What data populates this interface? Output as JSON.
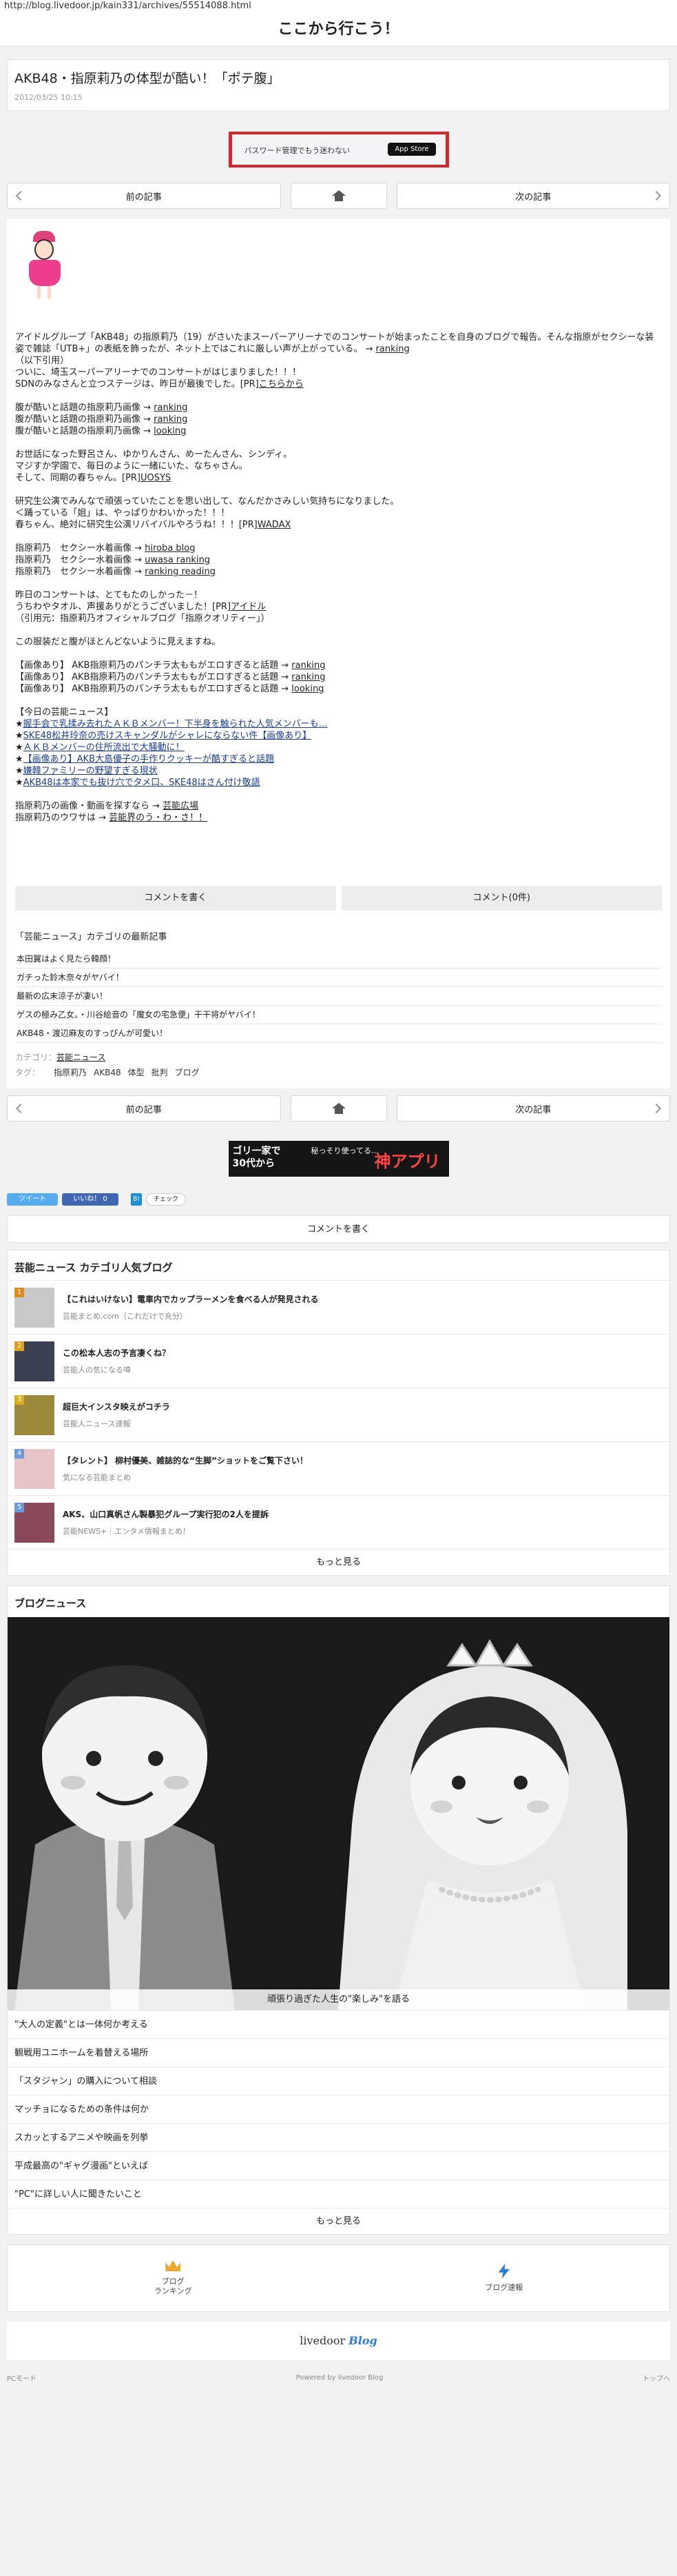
{
  "url": "http://blog.livedoor.jp/kain331/archives/55514088.html",
  "blog_title": "ここから行こう！",
  "article": {
    "title": "AKB48・指原莉乃の体型が酷い！「ポテ腹」",
    "date": "2012/03/25 10:15"
  },
  "ad_top": {
    "text": "パスワード管理でもう迷わない",
    "button": "App Store"
  },
  "nav": {
    "prev": "前の記事",
    "next": "次の記事"
  },
  "body": [
    {
      "t": "アイドルグループ「AKB48」の指原莉乃（19）がさいたまスーパーアリーナでのコンサートが始まったことを自身のブログで報告。そんな指原がセクシーな装姿で雑誌「UTB+」の表紙を飾ったが、ネット上ではこれに厳しい声が上がっている。 → ",
      "l": "ranking"
    },
    {
      "t": "（以下引用）"
    },
    {
      "t": "ついに、埼玉スーパーアリーナでのコンサートがはじまりました！！！"
    },
    {
      "t": "SDNのみなさんと立つステージは、昨日が最後でした。[PR]",
      "l": "こちらから"
    },
    {
      "gap": true
    },
    {
      "t": "腹が酷いと話題の指原莉乃画像 → ",
      "l": "ranking"
    },
    {
      "t": "腹が酷いと話題の指原莉乃画像 → ",
      "l": "ranking"
    },
    {
      "t": "腹が酷いと話題の指原莉乃画像 → ",
      "l": "looking"
    },
    {
      "gap": true
    },
    {
      "t": "お世話になった野呂さん、ゆかりんさん、めーたんさん、シンディ。"
    },
    {
      "t": "マジすか学園で、毎日のように一緒にいた、なちゃさん。"
    },
    {
      "t": "そして、同期の春ちゃん。[PR]",
      "l": "UOSYS"
    },
    {
      "gap": true
    },
    {
      "t": "研究生公演でみんなで頑張っていたことを思い出して、なんだかさみしい気持ちになりました。"
    },
    {
      "t": "＜踊っている「姐」は、やっぱりかわいかった！！！"
    },
    {
      "t": "春ちゃん、絶対に研究生公演リバイバルやろうね！！！[PR]",
      "l": "WADAX"
    },
    {
      "gap": true
    },
    {
      "t": "指原莉乃　セクシー水着画像 → ",
      "l": "hiroba blog"
    },
    {
      "t": "指原莉乃　セクシー水着画像 → ",
      "l": "uwasa ranking"
    },
    {
      "t": "指原莉乃　セクシー水着画像 → ",
      "l": "ranking reading"
    },
    {
      "gap": true
    },
    {
      "t": "昨日のコンサートは、とてもたのしかった－！"
    },
    {
      "t": "うちわやタオル、声援ありがとうございました！[PR]",
      "l": "アイドル"
    },
    {
      "t": "（引用元：指原莉乃オフィシャルブログ「指原クオリティー」）"
    },
    {
      "gap": true
    },
    {
      "t": "この服装だと腹がほとんどないように見えますね。"
    },
    {
      "gap": true
    },
    {
      "t": "【画像あり】 AKB指原莉乃のパンチラ太ももがエロすぎると話題 → ",
      "l": "ranking"
    },
    {
      "t": "【画像あり】 AKB指原莉乃のパンチラ太ももがエロすぎると話題 → ",
      "l": "ranking"
    },
    {
      "t": "【画像あり】 AKB指原莉乃のパンチラ太ももがエロすぎると話題 → ",
      "l": "looking"
    },
    {
      "gap": true
    },
    {
      "t": "【今日の芸能ニュース】"
    },
    {
      "t": "★",
      "l": "握手会で乳揉み去れたＡＫＢメンバー！下半身を触られた人気メンバーも…"
    },
    {
      "t": "★",
      "l": "SKE48松井玲奈の売けスキャンダルがシャレにならない件【画像あり】"
    },
    {
      "t": "★",
      "l": "ＡＫＢメンバーの住所流出で大騒動に！"
    },
    {
      "t": "★",
      "l": "【画像あり】AKB大島優子の手作りクッキーが酷すぎると話題"
    },
    {
      "t": "★",
      "l": "嫌韓ファミリーの野望すぎる現状"
    },
    {
      "t": "★",
      "l": "AKB48は本家でも抜け穴でタメ口、SKE48はさん付け敬語"
    },
    {
      "gap": true
    },
    {
      "t": "指原莉乃の画像・動画を探すなら → ",
      "l": "芸能広場"
    },
    {
      "t": "指原莉乃のウワサは → ",
      "l": "芸能界のう・わ・さ！！"
    }
  ],
  "comment_bar": {
    "write": "コメントを書く",
    "count": "コメント(0件)"
  },
  "category_latest": {
    "heading": "「芸能ニュース」カテゴリの最新記事",
    "items": [
      "本田翼はよく見たら韓顔！",
      "ガチった鈴木奈々がヤバイ！",
      "最新の広末涼子が凄い！",
      "ゲスの極み乙女。・川谷絵音の「魔女の宅急便」干干将がヤバイ！",
      "AKB48・渡辺麻友のすっぴんが可愛い！"
    ]
  },
  "meta": {
    "category_label": "カテゴリ：",
    "category": "芸能ニュース",
    "tags_label": "タグ：",
    "tags": [
      "指原莉乃",
      "AKB48",
      "体型",
      "批判",
      "ブログ"
    ]
  },
  "ad_mid": {
    "t1": "ゴリ一家で\n30代から",
    "t2": "秘っそり使ってる…",
    "t3": "神アプリ"
  },
  "social": {
    "tweet": "ツイート",
    "like": "いいね！ 0",
    "hatena": "B!",
    "check": "チェック"
  },
  "comment_write": "コメントを書く",
  "popular": {
    "heading": "芸能ニュース カテゴリ人気ブログ",
    "items": [
      {
        "rank": "1",
        "title": "【これはいけない】電車内でカップラーメンを食べる人が発見される",
        "src": "芸能まとめ.com（これだけで充分）"
      },
      {
        "rank": "2",
        "title": "この松本人志の予言凄くね？",
        "src": "芸能人の気になる噂"
      },
      {
        "rank": "3",
        "title": "超巨大インスタ映えがコチラ",
        "src": "芸能人ニュース速報"
      },
      {
        "rank": "4",
        "title": "【タレント】 柳村優美、雑誌的な“生脚”ショットをご覧下さい！",
        "src": "気になる芸能まとめ"
      },
      {
        "rank": "5",
        "title": "AKS、山口真帆さん製暴犯グループ実行犯の2人を提訴",
        "src": "芸能NEWS+｜エンタメ情報まとめ！"
      }
    ],
    "more": "もっと見る"
  },
  "blog_news": {
    "heading": "ブログニュース",
    "hero_caption": "頑張り過ぎた人生の\"楽しみ\"を語る",
    "items": [
      "\"大人の定義\"とは一体何か考える",
      "観戦用ユニホームを着替える場所",
      "「スタジャン」の購入について相談",
      "マッチョになるための条件は何か",
      "スカッとするアニメや映画を列挙",
      "平成最高の\"ギャグ漫画\"といえば",
      "\"PC\"に詳しい人に聞きたいこと"
    ],
    "more": "もっと見る"
  },
  "footer_nav": {
    "ranking": "ブログ\nランキング",
    "flash": "ブログ速報"
  },
  "livedoor": {
    "a": "livedoor",
    "b": "Blog"
  },
  "foot": {
    "pc": "PCモード",
    "powered": "Powered by livedoor Blog",
    "top": "トップへ"
  },
  "colors": {
    "twitter": "#55acee",
    "facebook": "#4267b2",
    "accent": "#2b7bd6",
    "ad_border": "#d9262a"
  }
}
